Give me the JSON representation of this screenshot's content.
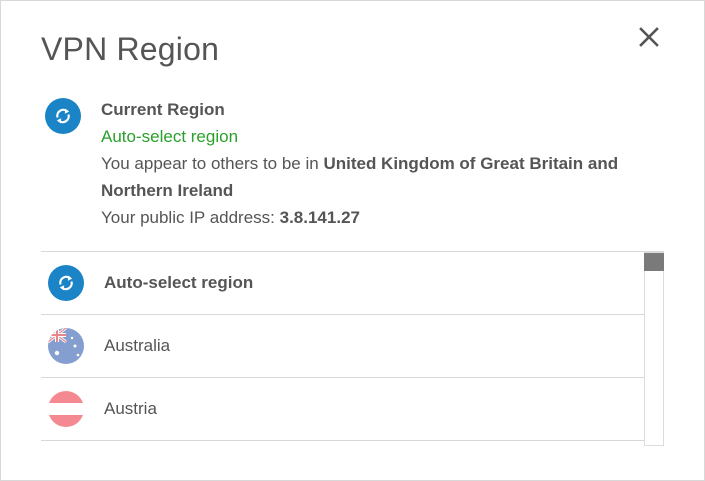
{
  "dialog": {
    "title": "VPN Region",
    "close_icon": "close-icon"
  },
  "current": {
    "icon": "sync-icon",
    "heading": "Current Region",
    "status": "Auto-select region",
    "status_color": "#2aa02a",
    "appear_prefix": "You appear to others to be in ",
    "appear_country": "United Kingdom of Great Britain and Northern Ireland",
    "ip_prefix": "Your public IP address: ",
    "ip_value": "3.8.141.27"
  },
  "regions": [
    {
      "label": "Auto-select region",
      "icon": "sync-icon",
      "bold": true
    },
    {
      "label": "Australia",
      "icon": "australia-flag-icon",
      "bold": false
    },
    {
      "label": "Austria",
      "icon": "austria-flag-icon",
      "bold": false
    }
  ],
  "colors": {
    "accent_blue": "#1a84c6",
    "divider": "#d8d8d8",
    "scroll_thumb": "#7a7a7a"
  }
}
